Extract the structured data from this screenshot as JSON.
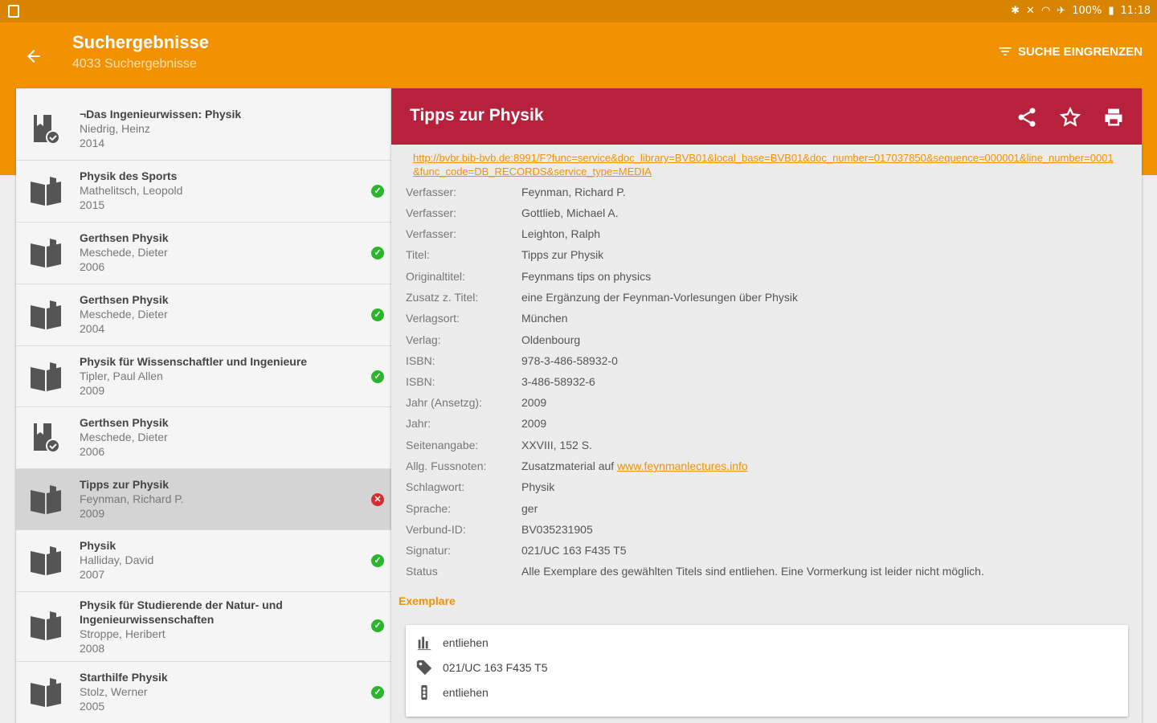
{
  "status_bar": {
    "battery": "100%",
    "time": "11:18"
  },
  "app_bar": {
    "title": "Suchergebnisse",
    "subtitle": "4033 Suchergebnisse",
    "filter_label": "SUCHE EINGRENZEN"
  },
  "results": [
    {
      "title": "¬Das Ingenieurwissen: Physik",
      "author": "Niedrig, Heinz",
      "year": "2014",
      "icon": "book-save-icon",
      "status": "none"
    },
    {
      "title": "Physik des Sports",
      "author": "Mathelitsch, Leopold",
      "year": "2015",
      "icon": "open-book-icon",
      "status": "available"
    },
    {
      "title": "Gerthsen Physik",
      "author": "Meschede, Dieter",
      "year": "2006",
      "icon": "open-book-icon",
      "status": "available"
    },
    {
      "title": "Gerthsen Physik",
      "author": "Meschede, Dieter",
      "year": "2004",
      "icon": "open-book-icon",
      "status": "available"
    },
    {
      "title": "Physik für Wissenschaftler und Ingenieure",
      "author": "Tipler, Paul Allen",
      "year": "2009",
      "icon": "open-book-icon",
      "status": "available"
    },
    {
      "title": "Gerthsen Physik",
      "author": "Meschede, Dieter",
      "year": "2006",
      "icon": "book-save-icon",
      "status": "none"
    },
    {
      "title": "Tipps zur Physik",
      "author": "Feynman, Richard P.",
      "year": "2009",
      "icon": "open-book-icon",
      "status": "unavailable"
    },
    {
      "title": "Physik",
      "author": "Halliday, David",
      "year": "2007",
      "icon": "open-book-icon",
      "status": "available"
    },
    {
      "title": "Physik für Studierende der Natur- und Ingenieurwissenschaften",
      "author": "Stroppe, Heribert",
      "year": "2008",
      "icon": "open-book-icon",
      "status": "available"
    },
    {
      "title": "Starthilfe Physik",
      "author": "Stolz, Werner",
      "year": "2005",
      "icon": "open-book-icon",
      "status": "available"
    }
  ],
  "detail": {
    "title": "Tipps zur Physik",
    "link": "http://bvbr.bib-bvb.de:8991/F?func=service&doc_library=BVB01&local_base=BVB01&doc_number=017037850&sequence=000001&line_number=0001&func_code=DB_RECORDS&service_type=MEDIA",
    "fields": [
      {
        "label": "Verfasser:",
        "value": "Feynman, Richard P."
      },
      {
        "label": "Verfasser:",
        "value": "Gottlieb, Michael A."
      },
      {
        "label": "Verfasser:",
        "value": "Leighton, Ralph"
      },
      {
        "label": "Titel:",
        "value": "Tipps zur Physik"
      },
      {
        "label": "Originaltitel:",
        "value": "Feynmans tips on physics"
      },
      {
        "label": "Zusatz z. Titel:",
        "value": "eine Ergänzung der Feynman-Vorlesungen über Physik"
      },
      {
        "label": "Verlagsort:",
        "value": "München"
      },
      {
        "label": "Verlag:",
        "value": "Oldenbourg"
      },
      {
        "label": "ISBN:",
        "value": "978-3-486-58932-0"
      },
      {
        "label": "ISBN:",
        "value": "3-486-58932-6"
      },
      {
        "label": "Jahr (Ansetzg):",
        "value": "2009"
      },
      {
        "label": "Jahr:",
        "value": "2009"
      },
      {
        "label": "Seitenangabe:",
        "value": "XXVIII, 152 S."
      },
      {
        "label": "Allg. Fussnoten:",
        "value": "Zusatzmaterial auf ",
        "link_text": "www.feynmanlectures.info"
      },
      {
        "label": "Schlagwort:",
        "value": "Physik"
      },
      {
        "label": "Sprache:",
        "value": "ger"
      },
      {
        "label": "Verbund-ID:",
        "value": "BV035231905"
      },
      {
        "label": "Signatur:",
        "value": "021/UC 163 F435 T5"
      },
      {
        "label": "Status",
        "value": "Alle Exemplare des gewählten Titels sind entliehen. Eine Vormerkung ist leider nicht möglich."
      }
    ],
    "exemplare_heading": "Exemplare",
    "copy": {
      "location": "entliehen",
      "signature": "021/UC 163 F435 T5",
      "status": "entliehen"
    }
  },
  "colors": {
    "primary": "#f39200",
    "primary_dark": "#d88400",
    "detail_header": "#b8213b",
    "available": "#2cb52c",
    "unavailable": "#d32f2f"
  }
}
